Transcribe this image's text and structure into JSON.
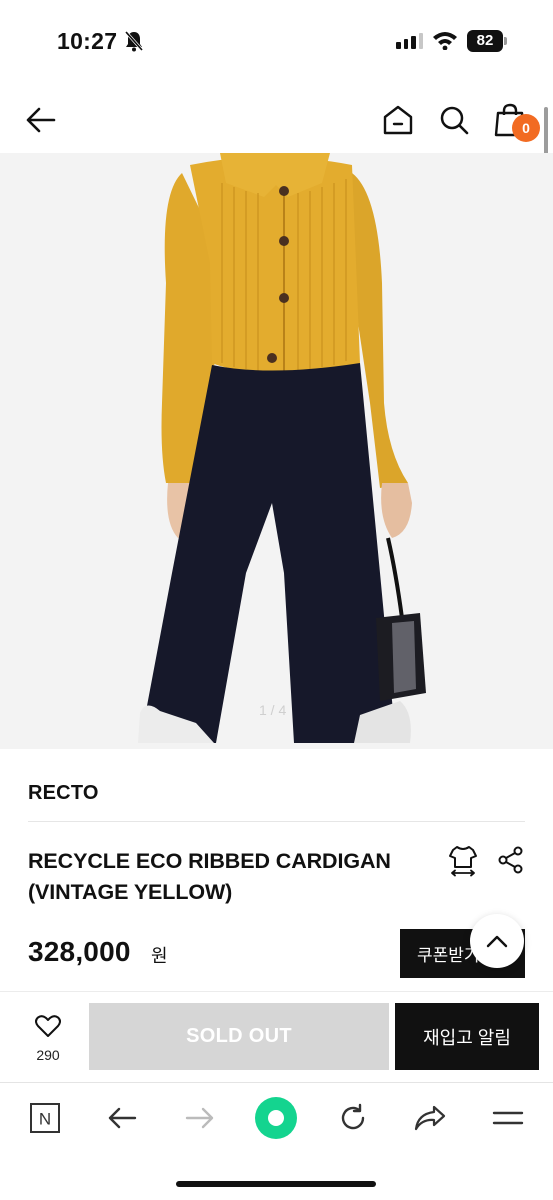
{
  "status_bar": {
    "time": "10:27",
    "battery": "82"
  },
  "cart": {
    "count": "0"
  },
  "gallery": {
    "counter": "1 / 4"
  },
  "product": {
    "brand": "RECTO",
    "title_line1": "RECYCLE ECO RIBBED CARDIGAN",
    "title_line2": "(VINTAGE YELLOW)",
    "price": "328,000",
    "currency": "원",
    "coupon_label": "쿠폰받기"
  },
  "purchase": {
    "likes": "290",
    "sold_out_label": "SOLD OUT",
    "restock_label": "재입고 알림"
  },
  "colors": {
    "accent": "#f26b22",
    "browser_accent": "#14d48f",
    "sold_out_bg": "#d6d6d6",
    "cardigan": "#e3ac2e",
    "trousers": "#16182a"
  },
  "icons": {
    "back": "back-arrow-icon",
    "home": "home-icon",
    "search": "search-icon",
    "cart": "shopping-bag-icon",
    "size": "size-guide-icon",
    "share": "share-icon",
    "like": "heart-icon",
    "scroll_top": "chevron-up-icon"
  },
  "browser_toolbar": {
    "items": [
      "naver-logo",
      "back",
      "forward",
      "green-dot",
      "reload",
      "share",
      "menu"
    ],
    "logo_text": "N"
  }
}
